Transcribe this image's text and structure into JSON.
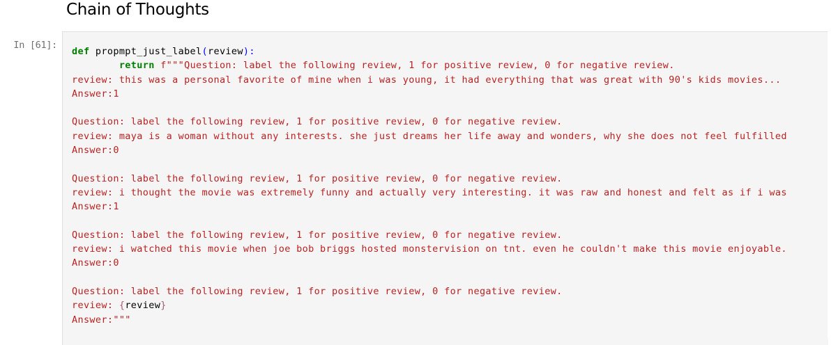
{
  "heading": "Chain of Thoughts",
  "cell": {
    "prompt": "In [61]:",
    "code": {
      "def_kw": "def",
      "func_name": " propmpt_just_label",
      "open_paren": "(",
      "param": "review",
      "close_paren": "):",
      "indent": "        ",
      "return_kw": "return",
      "fstring_prefix": " f\"\"\"Question: label the following review, 1 for positive review, 0 for negative review.",
      "lines": [
        "review: this was a personal favorite of mine when i was young, it had everything that was great with 90's kids movies...",
        "Answer:1",
        "",
        "Question: label the following review, 1 for positive review, 0 for negative review.",
        "review: maya is a woman without any interests. she just dreams her life away and wonders, why she does not feel fulfilled",
        "Answer:0",
        "",
        "Question: label the following review, 1 for positive review, 0 for negative review.",
        "review: i thought the movie was extremely funny and actually very interesting. it was raw and honest and felt as if i was",
        "Answer:1",
        "",
        "Question: label the following review, 1 for positive review, 0 for negative review.",
        "review: i watched this movie when joe bob briggs hosted monstervision on tnt. even he couldn't make this movie enjoyable.",
        "Answer:0",
        "",
        "Question: label the following review, 1 for positive review, 0 for negative review."
      ],
      "last_review_prefix": "review: ",
      "interp_open": "{",
      "interp_var": "review",
      "interp_close": "}",
      "last_answer": "Answer:\"\"\""
    }
  }
}
